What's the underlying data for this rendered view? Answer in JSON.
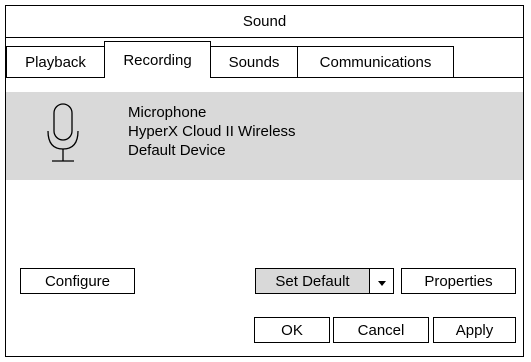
{
  "window": {
    "title": "Sound"
  },
  "tabs": [
    {
      "label": "Playback"
    },
    {
      "label": "Recording"
    },
    {
      "label": "Sounds"
    },
    {
      "label": "Communications"
    }
  ],
  "device": {
    "icon": "microphone-icon",
    "name": "Microphone",
    "model": "HyperX Cloud II Wireless",
    "status": "Default Device"
  },
  "buttons": {
    "configure": "Configure",
    "set_default": "Set Default",
    "properties": "Properties",
    "ok": "OK",
    "cancel": "Cancel",
    "apply": "Apply"
  }
}
